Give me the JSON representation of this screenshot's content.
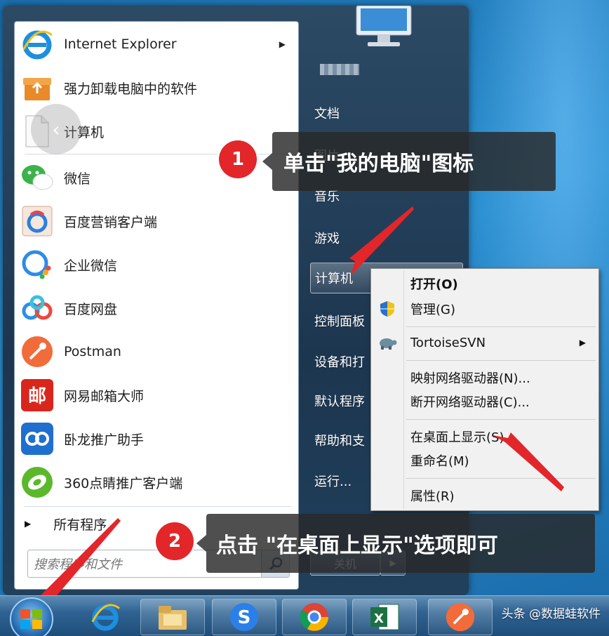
{
  "start_menu": {
    "programs": [
      {
        "label": "Internet Explorer",
        "icon": "ie-icon",
        "has_submenu": true
      },
      {
        "label": "强力卸载电脑中的软件",
        "icon": "uninstall-box-icon",
        "has_submenu": false
      },
      {
        "label": "计算机",
        "icon": "computer-file-icon",
        "has_submenu": false
      },
      {
        "label": "微信",
        "icon": "wechat-icon",
        "has_submenu": false
      },
      {
        "label": "百度营销客户端",
        "icon": "baidu-marketing-icon",
        "has_submenu": false
      },
      {
        "label": "企业微信",
        "icon": "wecom-icon",
        "has_submenu": false
      },
      {
        "label": "百度网盘",
        "icon": "baidu-netdisk-icon",
        "has_submenu": false
      },
      {
        "label": "Postman",
        "icon": "postman-icon",
        "has_submenu": false
      },
      {
        "label": "网易邮箱大师",
        "icon": "netease-mail-icon",
        "has_submenu": false
      },
      {
        "label": "卧龙推广助手",
        "icon": "wolong-icon",
        "has_submenu": false
      },
      {
        "label": "360点睛推广客户端",
        "icon": "360-dianjing-icon",
        "has_submenu": false
      }
    ],
    "all_programs": "所有程序",
    "search_placeholder": "搜索程序和文件",
    "right_items": [
      "文档",
      "图片",
      "音乐",
      "游戏",
      "计算机",
      "控制面板",
      "设备和打印机",
      "默认程序",
      "帮助和支持",
      "运行..."
    ],
    "right_items_visible": [
      "文档",
      "图片",
      "音乐",
      "游戏",
      "计算机",
      "控制面板",
      "设备和打",
      "默认程序",
      "帮助和支",
      "运行..."
    ],
    "user_name_blurred": "",
    "shutdown": "关机"
  },
  "context_menu": {
    "items": [
      {
        "label": "打开(O)",
        "bold": true,
        "icon": ""
      },
      {
        "label": "管理(G)",
        "bold": false,
        "icon": "uac-shield-icon"
      },
      {
        "label": "TortoiseSVN",
        "bold": false,
        "icon": "tortoise-icon",
        "has_submenu": true
      },
      {
        "label": "映射网络驱动器(N)...",
        "bold": false,
        "icon": ""
      },
      {
        "label": "断开网络驱动器(C)...",
        "bold": false,
        "icon": ""
      },
      {
        "label": "在桌面上显示(S)",
        "bold": false,
        "icon": ""
      },
      {
        "label": "重命名(M)",
        "bold": false,
        "icon": ""
      },
      {
        "label": "属性(R)",
        "bold": false,
        "icon": ""
      }
    ]
  },
  "callouts": {
    "step1": {
      "num": "1",
      "text": "单击\"我的电脑\"图标"
    },
    "step2": {
      "num": "2",
      "text": "点击 \"在桌面上显示\"选项即可"
    }
  },
  "watermark": "头条 @数据蛙软件",
  "colors": {
    "accent_red": "#e2262a",
    "callout_bg": "#282828",
    "taskbar": "#2f6393"
  }
}
